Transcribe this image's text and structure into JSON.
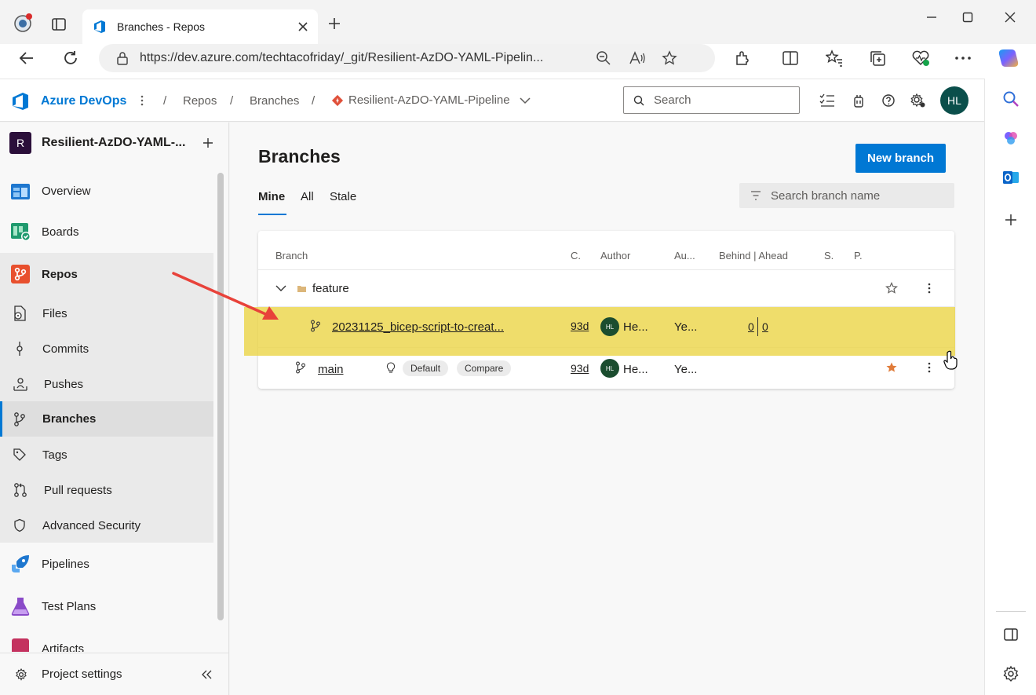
{
  "browser": {
    "tab_title": "Branches - Repos",
    "url": "https://dev.azure.com/techtacofriday/_git/Resilient-AzDO-YAML-Pipelin..."
  },
  "header": {
    "brand": "Azure DevOps",
    "breadcrumbs": [
      "Repos",
      "Branches",
      "Resilient-AzDO-YAML-Pipeline"
    ],
    "search_placeholder": "Search",
    "user_initials": "HL"
  },
  "sidebar": {
    "project_initial": "R",
    "project_name": "Resilient-AzDO-YAML-...",
    "items": [
      {
        "label": "Overview"
      },
      {
        "label": "Boards"
      },
      {
        "label": "Repos"
      },
      {
        "label": "Files"
      },
      {
        "label": "Commits"
      },
      {
        "label": "Pushes"
      },
      {
        "label": "Branches"
      },
      {
        "label": "Tags"
      },
      {
        "label": "Pull requests"
      },
      {
        "label": "Advanced Security"
      },
      {
        "label": "Pipelines"
      },
      {
        "label": "Test Plans"
      },
      {
        "label": "Artifacts"
      }
    ],
    "settings_label": "Project settings"
  },
  "main": {
    "title": "Branches",
    "new_branch_label": "New branch",
    "tabs": [
      "Mine",
      "All",
      "Stale"
    ],
    "filter_placeholder": "Search branch name",
    "columns": [
      "Branch",
      "C.",
      "Author",
      "Au...",
      "Behind | Ahead",
      "S.",
      "P."
    ],
    "folder_name": "feature",
    "rows": [
      {
        "name": "20231125_bicep-script-to-creat...",
        "commit": "93d",
        "author_initials": "HL",
        "author": "He...",
        "authored": "Ye...",
        "behind": "0",
        "ahead": "0"
      },
      {
        "name": "main",
        "tag_default": "Default",
        "tag_compare": "Compare",
        "commit": "93d",
        "author_initials": "HL",
        "author": "He...",
        "authored": "Ye..."
      }
    ]
  },
  "colors": {
    "accent": "#0078d4",
    "highlight": "#ecd64a",
    "arrow": "#e8423a",
    "star": "#e07b39"
  }
}
